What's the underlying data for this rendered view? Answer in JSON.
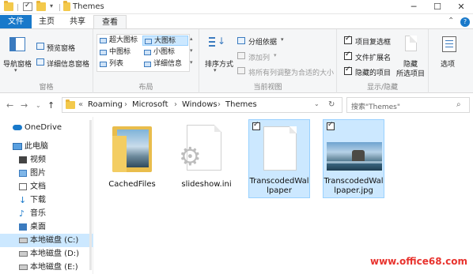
{
  "window": {
    "title": "Themes",
    "minimize": "─",
    "maximize": "☐",
    "close": "✕"
  },
  "tabs": {
    "file": "文件",
    "home": "主页",
    "share": "共享",
    "view": "查看"
  },
  "ribbon": {
    "pane": {
      "nav_pane": "导航窗格",
      "preview_pane": "预览窗格",
      "details_pane": "详细信息窗格",
      "group": "窗格"
    },
    "layout": {
      "items": [
        "超大图标",
        "大图标",
        "中图标",
        "小图标",
        "列表",
        "详细信息"
      ],
      "selected": "大图标",
      "group": "布局"
    },
    "current_view": {
      "sort": "排序方式",
      "group_by": "分组依据",
      "add_column": "添加列",
      "size_all": "将所有列调整为合适的大小",
      "group": "当前视图"
    },
    "show_hide": {
      "checkboxes": [
        "项目复选框",
        "文件扩展名",
        "隐藏的项目"
      ],
      "hide_selected": "隐藏\n所选项目",
      "hide_line1": "隐藏",
      "hide_line2": "所选项目",
      "group": "显示/隐藏"
    },
    "options": "选项"
  },
  "address": {
    "crumbs": [
      "Roaming",
      "Microsoft",
      "Windows",
      "Themes"
    ],
    "search_placeholder": "搜索\"Themes\""
  },
  "nav": [
    {
      "label": "OneDrive",
      "icon": "cloud-icon"
    },
    {
      "label": "此电脑",
      "icon": "computer-icon"
    },
    {
      "label": "视频",
      "icon": "video-icon"
    },
    {
      "label": "图片",
      "icon": "picture-icon"
    },
    {
      "label": "文档",
      "icon": "document-icon"
    },
    {
      "label": "下载",
      "icon": "download-icon"
    },
    {
      "label": "音乐",
      "icon": "music-icon"
    },
    {
      "label": "桌面",
      "icon": "desktop-icon"
    },
    {
      "label": "本地磁盘 (C:)",
      "icon": "drive-icon"
    },
    {
      "label": "本地磁盘 (D:)",
      "icon": "drive-icon"
    },
    {
      "label": "本地磁盘 (E:)",
      "icon": "drive-icon"
    }
  ],
  "files": [
    {
      "name": "CachedFiles",
      "type": "folder"
    },
    {
      "name": "slideshow.ini",
      "type": "settings-file"
    },
    {
      "name": "TranscodedWallpaper",
      "type": "file"
    },
    {
      "name": "TranscodedWallpaper.jpg",
      "type": "image"
    }
  ],
  "watermark": "www.office68.com",
  "colors": {
    "accent": "#1979ca",
    "selection": "#cce8ff",
    "selection_border": "#99d1ff",
    "watermark": "#e8332e"
  }
}
